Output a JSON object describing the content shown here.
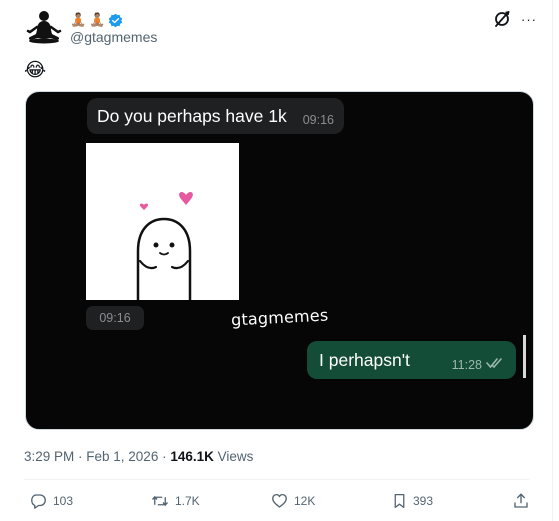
{
  "tweet": {
    "name_emojis": [
      "🧘🏽",
      "🧘🏽"
    ],
    "handle": "@gtagmemes",
    "text": "😂",
    "media": {
      "incoming_message": "Do you perhaps have 1k",
      "incoming_time": "09:16",
      "image_time": "09:16",
      "watermark": "gtagmemes",
      "outgoing_message": "I perhapsn't",
      "outgoing_time": "11:28"
    },
    "timestamp": "3:29 PM · Feb 1, 2026 · ",
    "views_count": "146.1K",
    "views_label": " Views",
    "replies": "103",
    "reposts": "1.7K",
    "likes": "12K",
    "bookmarks": "393"
  },
  "colors": {
    "accent_blue": "#1d9bf0",
    "outgoing_bubble": "#144d37",
    "incoming_bubble": "#1f2022",
    "heart_pink": "#e75a9f"
  },
  "icons": [
    "meditation-avatar-icon",
    "verified-badge-icon",
    "grok-icon",
    "more-icon",
    "heart-icon",
    "double-check-icon",
    "reply-icon",
    "repost-icon",
    "like-icon",
    "bookmark-icon",
    "share-icon"
  ]
}
